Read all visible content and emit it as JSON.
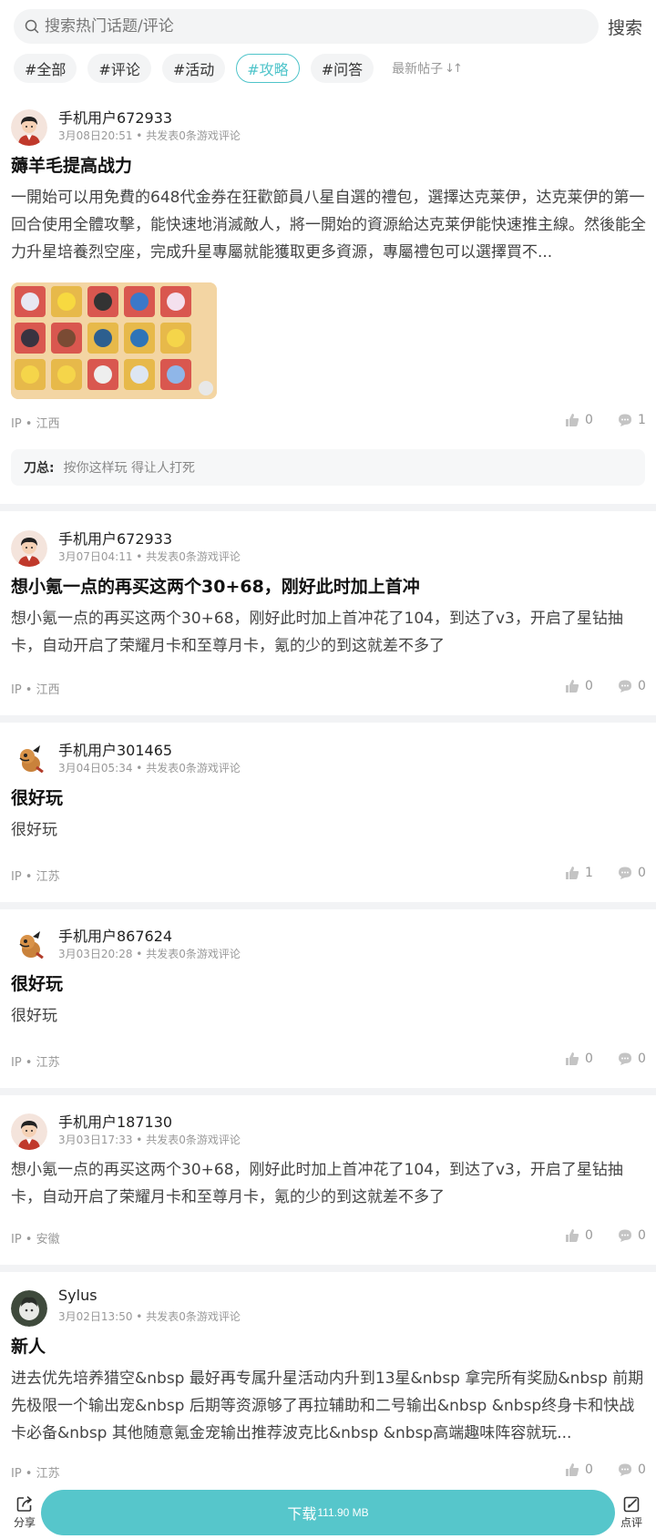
{
  "search": {
    "placeholder": "搜索热门话题/评论",
    "button": "搜索"
  },
  "tabs": [
    {
      "label": "#全部",
      "active": false
    },
    {
      "label": "#评论",
      "active": false
    },
    {
      "label": "#活动",
      "active": false
    },
    {
      "label": "#攻略",
      "active": true
    },
    {
      "label": "#问答",
      "active": false
    }
  ],
  "sort_label": "最新帖子",
  "sort_icon": "sort-arrows-icon",
  "accent_color": "#4fc4ca",
  "posts": [
    {
      "user": "手机用户672933",
      "meta": "3月08日20:51 • 共发表0条游戏评论",
      "title": "薅羊毛提高战力",
      "body": "一開始可以用免費的648代金券在狂歡節員八星自選的禮包，選擇达克莱伊，达克莱伊的第一回合使用全體攻擊，能快速地消滅敵人，將一開始的資源給达克莱伊能快速推主線。然後能全力升星培養烈空座，完成升星專屬就能獲取更多資源，專屬禮包可以選擇買不...",
      "ip": "IP • 江西",
      "likes": "0",
      "comments": "1",
      "reply_user": "刀总:",
      "reply_text": "按你这样玩 得让人打死"
    },
    {
      "user": "手机用户672933",
      "meta": "3月07日04:11 • 共发表0条游戏评论",
      "title": "想小氪一点的再买这两个30+68，刚好此时加上首冲",
      "body": "想小氪一点的再买这两个30+68，刚好此时加上首冲花了104，到达了v3，开启了星钻抽卡，自动开启了荣耀月卡和至尊月卡，氪的少的到这就差不多了",
      "ip": "IP • 江西",
      "likes": "0",
      "comments": "0"
    },
    {
      "user": "手机用户301465",
      "meta": "3月04日05:34 • 共发表0条游戏评论",
      "title": "很好玩",
      "body": "很好玩",
      "ip": "IP • 江苏",
      "likes": "1",
      "comments": "0"
    },
    {
      "user": "手机用户867624",
      "meta": "3月03日20:28 • 共发表0条游戏评论",
      "title": "很好玩",
      "body": "很好玩",
      "ip": "IP • 江苏",
      "likes": "0",
      "comments": "0"
    },
    {
      "user": "手机用户187130",
      "meta": "3月03日17:33 • 共发表0条游戏评论",
      "body": "想小氪一点的再买这两个30+68，刚好此时加上首冲花了104，到达了v3，开启了星钻抽卡，自动开启了荣耀月卡和至尊月卡，氪的少的到这就差不多了",
      "ip": "IP • 安徽",
      "likes": "0",
      "comments": "0"
    },
    {
      "user": "Sylus",
      "meta": "3月02日13:50 • 共发表0条游戏评论",
      "title": "新人",
      "body": "进去优先培养猎空&nbsp 最好再专属升星活动内升到13星&nbsp 拿完所有奖励&nbsp 前期先极限一个输出宠&nbsp 后期等资源够了再拉辅助和二号输出&nbsp &nbsp终身卡和快战卡必备&nbsp 其他随意氪金宠输出推荐波克比&nbsp &nbsp高端趣味阵容就玩...",
      "ip": "IP • 江苏",
      "likes": "0",
      "comments": "0"
    }
  ],
  "bottom": {
    "share_label": "分享",
    "download_label": "下载",
    "download_size": "111.90 MB",
    "review_label": "点评"
  }
}
